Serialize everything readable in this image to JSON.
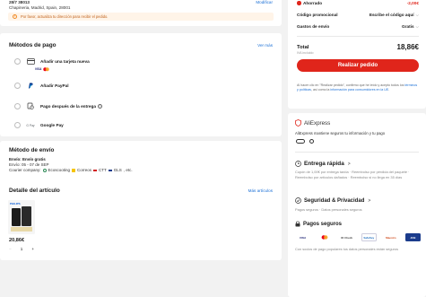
{
  "address": {
    "line1": "28/7 38013",
    "line2": "Chapineria, Madrid, Spain, 28001",
    "edit_label": "Modificar",
    "warning": "Por favor, actualiza tu dirección para recibir el pedido."
  },
  "payment": {
    "title": "Métodos de pago",
    "see_more": "Ver más",
    "methods": [
      {
        "label": "Añadir una tarjeta nueva",
        "icon": "card-icon"
      },
      {
        "label": "Añadir PayPal",
        "icon": "paypal-icon"
      },
      {
        "label": "Pago después de la entrega",
        "icon": "pay-later-icon"
      },
      {
        "label": "Google Pay",
        "icon": "google-pay-icon",
        "prefix": "G Pay"
      }
    ]
  },
  "shipping": {
    "title": "Método de envío",
    "line1": "Envío: Envío gratis",
    "line2": "Envío: 05 - 07 de SEP",
    "courier_prefix": "Courier company:",
    "couriers": [
      "Ecoscooting",
      "Correos",
      "CTT",
      "GLS"
    ],
    "courier_suffix": ", etc."
  },
  "item": {
    "title": "Detalle del artículo",
    "more": "Más artículos",
    "brand": "PHILIPS",
    "price": "20,86€",
    "qty": "1",
    "minus": "−",
    "plus": "+"
  },
  "summary": {
    "savings_label": "Ahorrado",
    "savings_value": "-2,00€",
    "promo_label": "Código promocional",
    "promo_action": "Escribe el código aquí",
    "shipping_label": "Gastos de envío",
    "shipping_value": "Gratis",
    "total_label": "Total",
    "total_value": "18,86€",
    "tax_note": "IVA incluido",
    "order_button": "Realizar pedido",
    "terms_prefix": "Al hacer clic en \"Realizar pedido\", confirmo que he leído y acepto todos los ",
    "terms_link": "términos y políticas",
    "terms_mid": ", así como la ",
    "terms_link2": "información para consumidores en la UE",
    "terms_end": "."
  },
  "aliexpress": {
    "brand": "AliExpress",
    "trust_text": "AliExpress mantiene seguros tu información y tu pago"
  },
  "delivery": {
    "title": "Entrega rápida",
    "arrow": ">",
    "text": "Cupón de 1,00€ por entrega tardía  ·  Reembolso por pérdida del paquete  ·  Reembolso por artículos dañados  ·  Reembolso si no llega en 35 días"
  },
  "security": {
    "title": "Seguridad & Privacidad",
    "arrow": ">",
    "text": "Pagos seguros  ·  Datos personales seguros"
  },
  "secure_payments": {
    "title": "Pagos seguros",
    "logos": [
      "VISA",
      "Mastercard",
      "ID Check",
      "SafeKey",
      "Maestro",
      "JCB"
    ],
    "text": "Con socios de pago populares tus datos personales están seguros"
  },
  "colors": {
    "accent": "#e0251b",
    "link": "#1a6fd6",
    "background": "#f2f2f2"
  }
}
